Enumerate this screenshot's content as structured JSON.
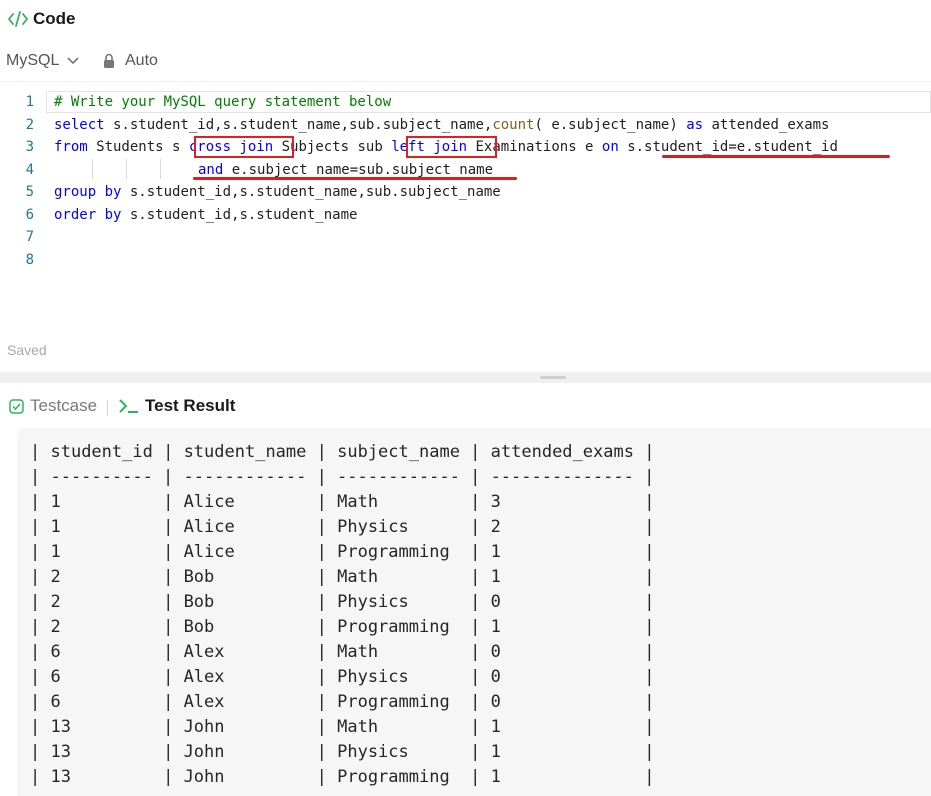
{
  "header": {
    "title": "Code",
    "icon": "code-icon"
  },
  "toolbar": {
    "language": "MySQL",
    "mode": "Auto"
  },
  "editor": {
    "line_numbers": [
      "1",
      "2",
      "3",
      "4",
      "5",
      "6",
      "7",
      "8"
    ],
    "comment": "# Write your MySQL query statement below",
    "l2": {
      "kw_select": "select",
      "text_a": " s.student_id,s.student_name,sub.subject_name,",
      "fn_count": "count",
      "text_b": "( e.subject_name) ",
      "kw_as": "as",
      "text_c": " attended_exams"
    },
    "l3": {
      "kw_from": "from",
      "text_a": " Students s ",
      "kw_cross_join": "cross join",
      "text_b": " Subjects sub ",
      "kw_left_join": "left join",
      "text_c": " Examinations e ",
      "kw_on": "on",
      "text_d": " s.student_id=e.student_id"
    },
    "l4": {
      "kw_and": "and",
      "text_a": " e.subject_name=sub.subject_name"
    },
    "l5": {
      "kw_group_by": "group by",
      "text_a": " s.student_id,s.student_name,sub.subject_name"
    },
    "l6": {
      "kw_order_by": "order by",
      "text_a": " s.student_id,s.student_name"
    }
  },
  "status": {
    "saved": "Saved"
  },
  "panel": {
    "tab_testcase": "Testcase",
    "tab_result": "Test Result"
  },
  "result": {
    "columns": [
      "student_id",
      "student_name",
      "subject_name",
      "attended_exams"
    ],
    "rows": [
      [
        "1",
        "Alice",
        "Math",
        "3"
      ],
      [
        "1",
        "Alice",
        "Physics",
        "2"
      ],
      [
        "1",
        "Alice",
        "Programming",
        "1"
      ],
      [
        "2",
        "Bob",
        "Math",
        "1"
      ],
      [
        "2",
        "Bob",
        "Physics",
        "0"
      ],
      [
        "2",
        "Bob",
        "Programming",
        "1"
      ],
      [
        "6",
        "Alex",
        "Math",
        "0"
      ],
      [
        "6",
        "Alex",
        "Physics",
        "0"
      ],
      [
        "6",
        "Alex",
        "Programming",
        "0"
      ],
      [
        "13",
        "John",
        "Math",
        "1"
      ],
      [
        "13",
        "John",
        "Physics",
        "1"
      ],
      [
        "13",
        "John",
        "Programming",
        "1"
      ]
    ]
  },
  "colors": {
    "accent_green": "#2db55d",
    "keyword": "#0000ff",
    "comment": "#008000",
    "highlight": "#e02020"
  }
}
